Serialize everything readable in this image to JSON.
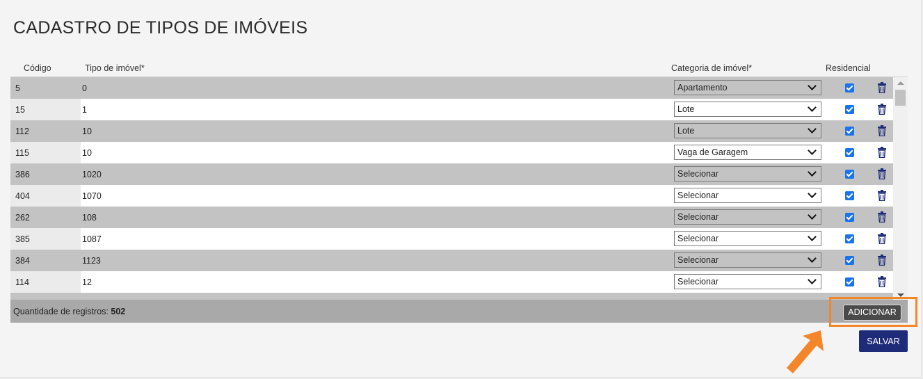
{
  "page": {
    "title": "CADASTRO DE TIPOS DE IMÓVEIS"
  },
  "table": {
    "headers": {
      "codigo": "Código",
      "tipo": "Tipo de imóvel*",
      "categoria": "Categoria de imóvel*",
      "residencial": "Residencial"
    },
    "rows": [
      {
        "codigo": "5",
        "tipo": "0",
        "categoria": "Apartamento",
        "residencial": true
      },
      {
        "codigo": "15",
        "tipo": "1",
        "categoria": "Lote",
        "residencial": true
      },
      {
        "codigo": "112",
        "tipo": "10",
        "categoria": "Lote",
        "residencial": true
      },
      {
        "codigo": "115",
        "tipo": "10",
        "categoria": "Vaga de Garagem",
        "residencial": true
      },
      {
        "codigo": "386",
        "tipo": "1020",
        "categoria": "Selecionar",
        "residencial": true
      },
      {
        "codigo": "404",
        "tipo": "1070",
        "categoria": "Selecionar",
        "residencial": true
      },
      {
        "codigo": "262",
        "tipo": "108",
        "categoria": "Selecionar",
        "residencial": true
      },
      {
        "codigo": "385",
        "tipo": "1087",
        "categoria": "Selecionar",
        "residencial": true
      },
      {
        "codigo": "384",
        "tipo": "1123",
        "categoria": "Selecionar",
        "residencial": true
      },
      {
        "codigo": "114",
        "tipo": "12",
        "categoria": "Selecionar",
        "residencial": true
      }
    ]
  },
  "footer": {
    "count_label": "Quantidade de registros: ",
    "count_value": "502"
  },
  "buttons": {
    "add_label": "ADICIONAR",
    "save_label": "SALVAR"
  },
  "colors": {
    "row_odd": "#c3c3c3",
    "row_even": "#ffffff",
    "checkbox": "#1a73e8",
    "trash": "#1d2b78",
    "save_button": "#1d2b78",
    "highlight": "#f4862a"
  },
  "icons": {
    "delete": "trash-icon",
    "residencial": "checkbox-checked-icon",
    "annotation": "arrow-icon"
  }
}
